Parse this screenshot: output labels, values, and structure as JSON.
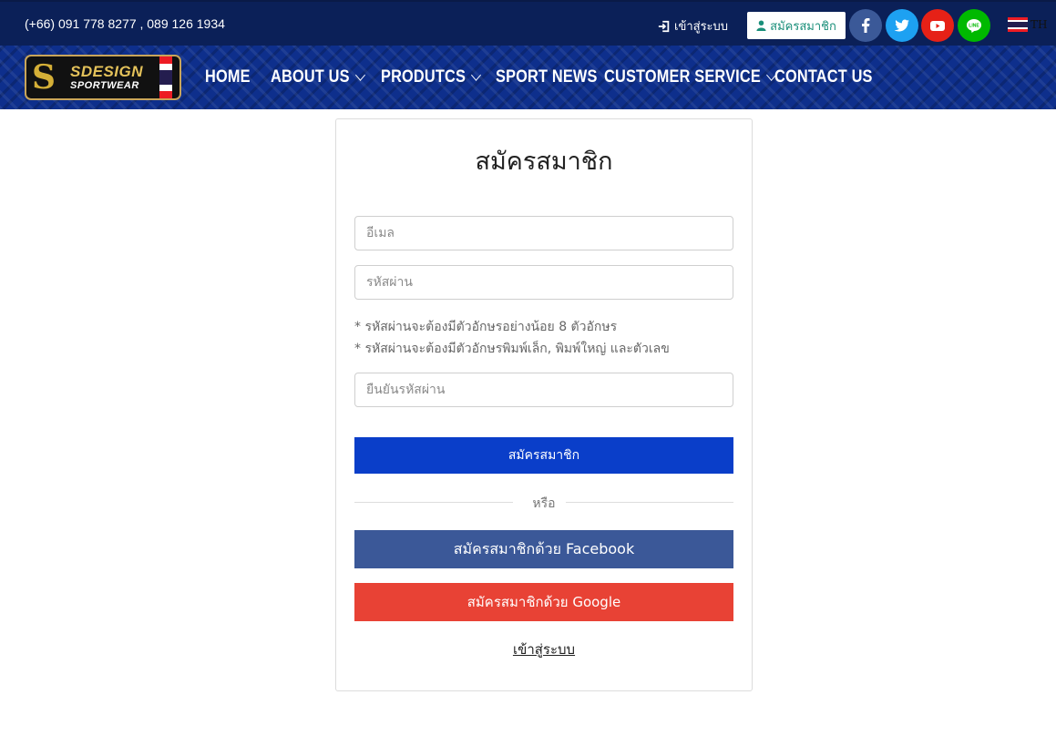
{
  "topbar": {
    "phone": "(+66) 091 778 8277 , 089 126 1934",
    "login_label": "เข้าสู่ระบบ",
    "login_icon": "sign-in-icon",
    "register_label": "สมัครสมาชิก",
    "register_icon": "user-icon",
    "socials": [
      {
        "name": "facebook",
        "icon": "facebook-icon",
        "color": "#3b5998"
      },
      {
        "name": "twitter",
        "icon": "twitter-icon",
        "color": "#1da1f2"
      },
      {
        "name": "youtube",
        "icon": "youtube-icon",
        "color": "#e62117"
      },
      {
        "name": "line",
        "icon": "line-icon",
        "color": "#00b900"
      }
    ],
    "language": "TH"
  },
  "logo": {
    "initial": "S",
    "brand_top": "SDESIGN",
    "brand_bottom": "SPORTWEAR"
  },
  "nav": {
    "items": [
      {
        "label": "HOME",
        "has_dropdown": false
      },
      {
        "label": "ABOUT US",
        "has_dropdown": true
      },
      {
        "label": "PRODUTCS",
        "has_dropdown": true
      },
      {
        "label": "SPORT NEWS",
        "has_dropdown": false
      },
      {
        "label": "CUSTOMER SERVICE",
        "has_dropdown": true
      },
      {
        "label": "CONTACT US",
        "has_dropdown": false
      }
    ]
  },
  "form": {
    "title": "สมัครสมาชิก",
    "email_placeholder": "อีเมล",
    "password_placeholder": "รหัสผ่าน",
    "hints": [
      "* รหัสผ่านจะต้องมีตัวอักษรอย่างน้อย 8 ตัวอักษร",
      "* รหัสผ่านจะต้องมีตัวอักษรพิมพ์เล็ก, พิมพ์ใหญ่ และตัวเลข"
    ],
    "confirm_placeholder": "ยืนยันรหัสผ่าน",
    "submit_label": "สมัครสมาชิก",
    "or_label": "หรือ",
    "facebook_label": "สมัครสมาชิกด้วย Facebook",
    "google_label": "สมัครสมาชิกด้วย Google",
    "login_link": "เข้าสู่ระบบ"
  },
  "colors": {
    "topbar": "#0b2058",
    "nav": "#0e2f8c",
    "primary_button": "#0a3ec9",
    "facebook_button": "#3b5898",
    "google_button": "#e84235",
    "logo_gold": "#d4af37"
  }
}
